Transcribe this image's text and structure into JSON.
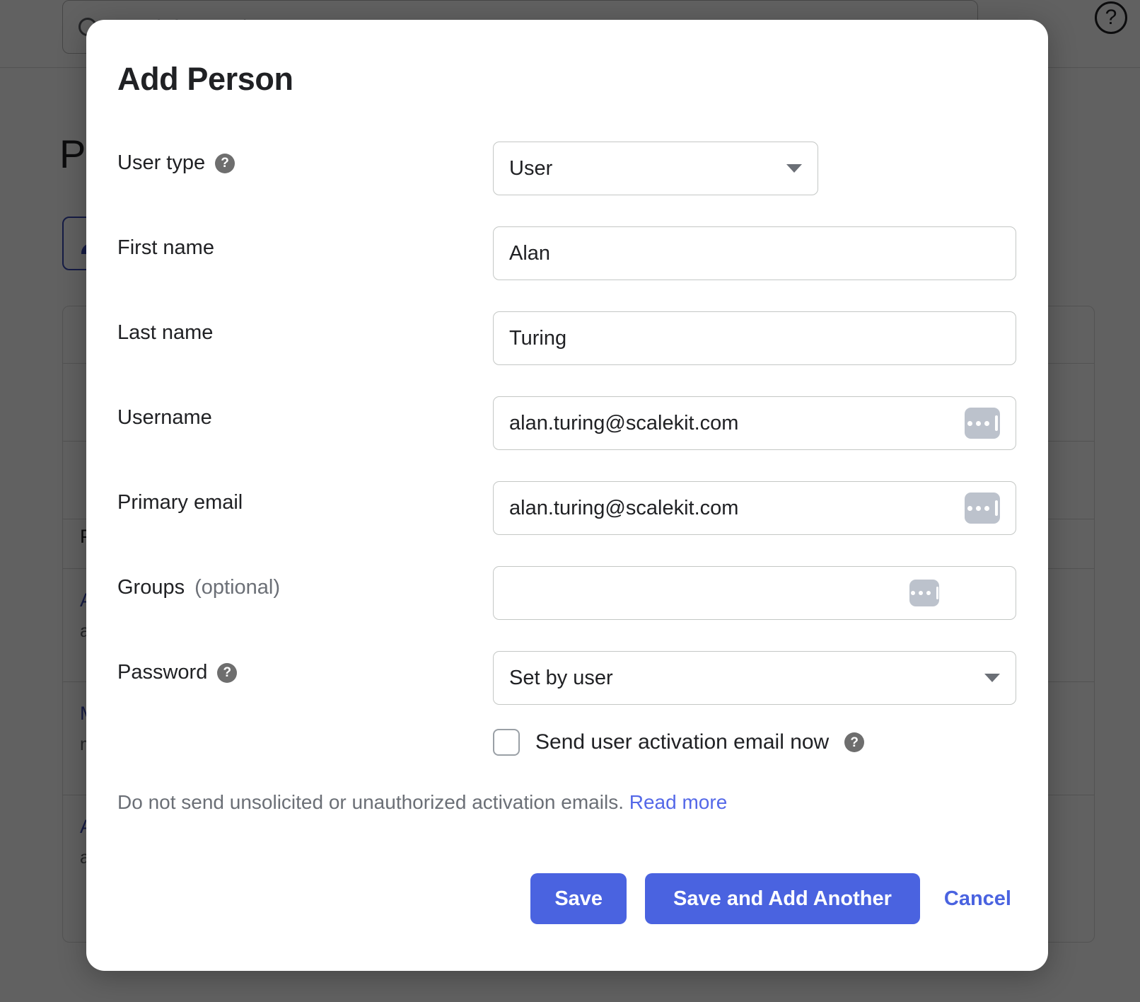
{
  "background": {
    "search_placeholder": "Search for people, groups...",
    "search_icon": "search-icon",
    "help_icon": "help-circle-icon",
    "heading": "People",
    "add_person_icon": "add-person-icon",
    "table_header": "Person",
    "rows": [
      {
        "name": "Alan Turing",
        "email": "alan.turing@scalekit.com"
      },
      {
        "name": "Marie Curie",
        "email": "marie.curie@scalekit.com"
      },
      {
        "name": "Ada Lovelace",
        "email": "ada.lovelace@scalekit.com"
      }
    ]
  },
  "modal": {
    "title": "Add Person",
    "fields": [
      {
        "label": "User type",
        "help_icon": "help-circle-icon",
        "has_help": true,
        "control": "select",
        "value": "User",
        "narrow": true,
        "caret_icon": "chevron-down-icon",
        "name": "user-type"
      },
      {
        "label": "First name",
        "has_help": false,
        "control": "input",
        "value": "Alan",
        "name": "first-name"
      },
      {
        "label": "Last name",
        "has_help": false,
        "control": "input",
        "value": "Turing",
        "name": "last-name"
      },
      {
        "label": "Username",
        "has_help": false,
        "control": "input",
        "value": "alan.turing@scalekit.com",
        "trailing_icon": "ellipsis-field-picker-icon",
        "name": "username"
      },
      {
        "label": "Primary email",
        "has_help": false,
        "control": "input",
        "value": "alan.turing@scalekit.com",
        "trailing_icon": "ellipsis-field-picker-icon",
        "name": "primary-email"
      },
      {
        "label": "Groups",
        "label_suffix": "(optional)",
        "has_help": false,
        "control": "input",
        "value": "",
        "trailing_icon": "ellipsis-field-picker-icon",
        "trailing_small": true,
        "name": "groups"
      },
      {
        "label": "Password",
        "help_icon": "help-circle-icon",
        "has_help": true,
        "control": "select",
        "value": "Set by user",
        "caret_icon": "chevron-down-icon",
        "name": "password"
      }
    ],
    "checkbox": {
      "label": "Send user activation email now",
      "checked": false,
      "help_icon": "help-circle-icon"
    },
    "note": {
      "text": "Do not send unsolicited or unauthorized activation emails.",
      "link": "Read more"
    },
    "buttons": {
      "save": "Save",
      "save_add_another": "Save and Add Another",
      "cancel": "Cancel"
    }
  },
  "colors": {
    "accent": "#4a63e0",
    "link": "#5468e8",
    "text": "#202124",
    "muted": "#6b6f76",
    "border": "#c4c7c5",
    "icon_chip": "#bcc2cc",
    "overlay": "rgba(0,0,0,0.62)"
  }
}
